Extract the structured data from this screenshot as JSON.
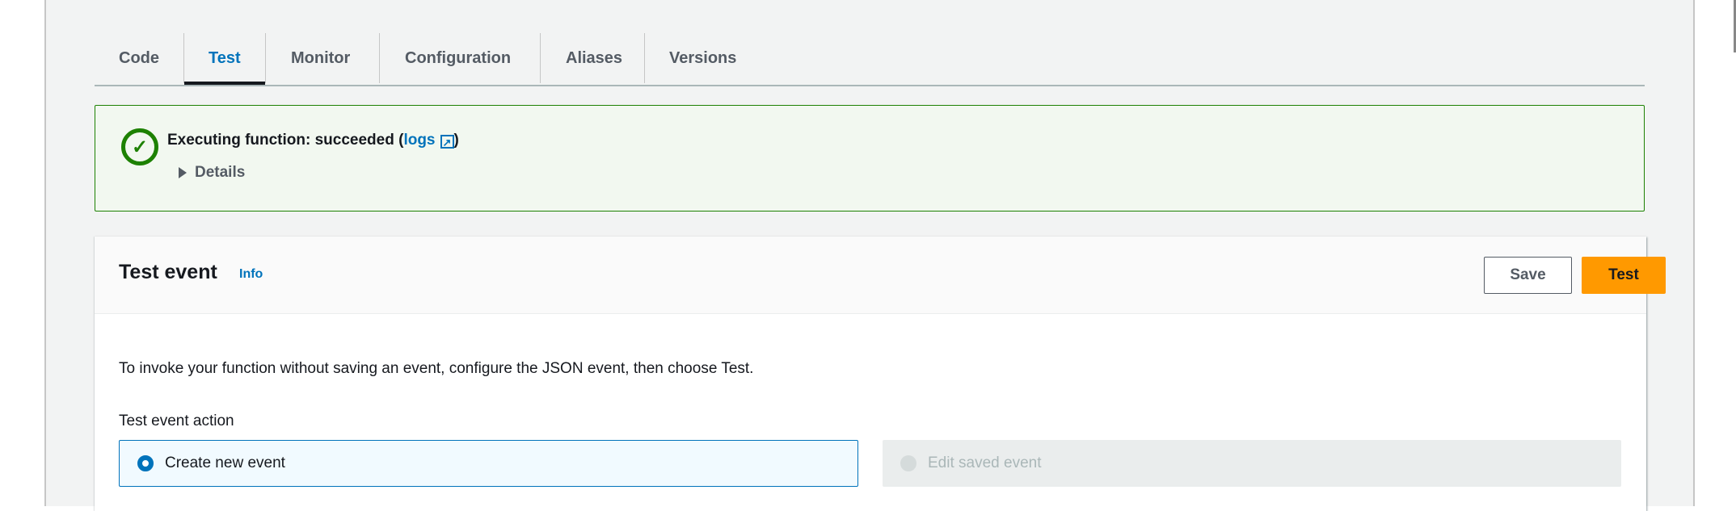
{
  "tabs": [
    {
      "label": "Code"
    },
    {
      "label": "Test"
    },
    {
      "label": "Monitor"
    },
    {
      "label": "Configuration"
    },
    {
      "label": "Aliases"
    },
    {
      "label": "Versions"
    }
  ],
  "alert": {
    "title": "Executing function: succeeded",
    "open_paren": "(",
    "link": "logs",
    "close_paren": ")",
    "details": "Details",
    "status_color": "#1d8102"
  },
  "card": {
    "title": "Test event",
    "info": "Info",
    "save_label": "Save",
    "test_label": "Test",
    "description": "To invoke your function without saving an event, configure the JSON event, then choose Test.",
    "action_label": "Test event action",
    "options": [
      {
        "label": "Create new event",
        "selected": true
      },
      {
        "label": "Edit saved event",
        "selected": false,
        "disabled": true
      }
    ]
  },
  "colors": {
    "accent": "#0073bb",
    "primary_button": "#ff9900"
  }
}
